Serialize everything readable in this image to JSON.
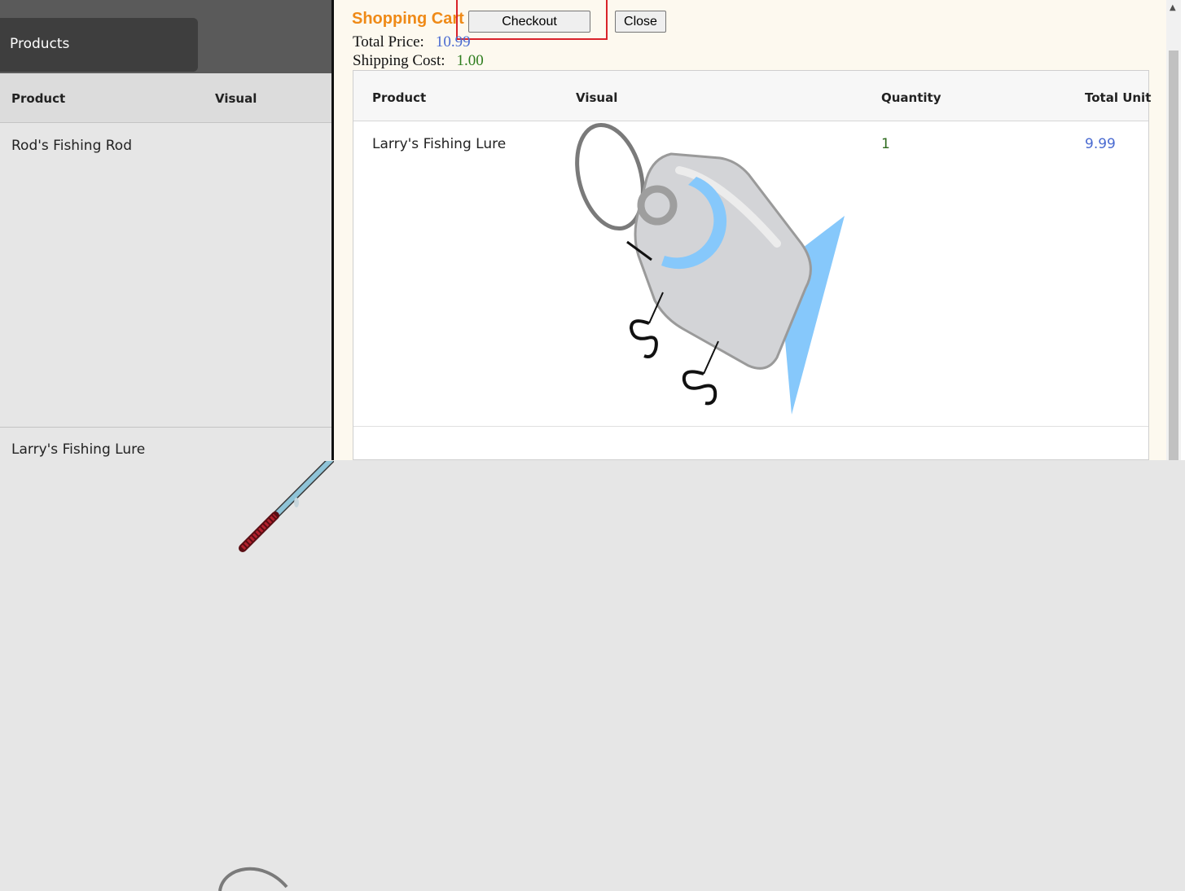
{
  "background": {
    "tab_label": "Products",
    "columns": [
      "Product",
      "Visual"
    ],
    "rows": [
      "Rod's Fishing Rod",
      "Larry's Fishing Lure"
    ]
  },
  "cart": {
    "title": "Shopping Cart",
    "checkout_label": "Checkout",
    "close_label": "Close",
    "total_price_label": "Total Price:",
    "total_price_value": "10.99",
    "shipping_cost_label": "Shipping Cost:",
    "shipping_cost_value": "1.00",
    "columns": [
      "Product",
      "Visual",
      "Quantity",
      "Total Unit"
    ],
    "items": [
      {
        "product": "Larry's Fishing Lure",
        "visual": "fishing-lure-image",
        "quantity": "1",
        "total_unit": "9.99"
      }
    ]
  },
  "colors": {
    "title": "#ef8a17",
    "price": "#4a6bd1",
    "shipping": "#2e7d1e",
    "highlight": "#d9232a"
  }
}
